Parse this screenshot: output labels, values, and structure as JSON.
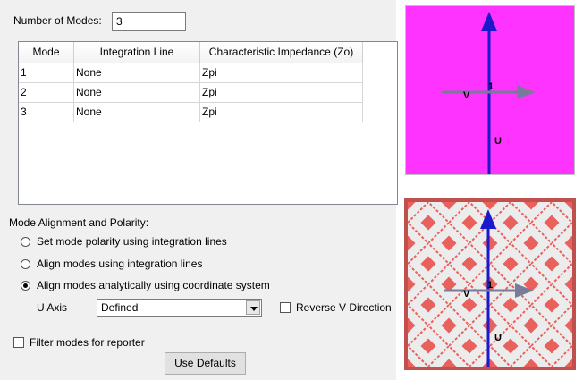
{
  "modes": {
    "label": "Number of Modes:",
    "value": "3"
  },
  "table": {
    "columns": [
      "Mode",
      "Integration Line",
      "Characteristic Impedance (Zo)"
    ],
    "rows": [
      [
        "1",
        "None",
        "Zpi"
      ],
      [
        "2",
        "None",
        "Zpi"
      ],
      [
        "3",
        "None",
        "Zpi"
      ]
    ]
  },
  "alignment": {
    "heading": "Mode Alignment and Polarity:",
    "options": [
      "Set mode polarity using integration lines",
      "Align modes using integration lines",
      "Align modes analytically using coordinate system"
    ],
    "selected_index": 2
  },
  "u_axis": {
    "label": "U Axis",
    "value": "Defined"
  },
  "reverse_v": {
    "label": "Reverse V Direction",
    "checked": false
  },
  "filter": {
    "label": "Filter modes for reporter",
    "checked": false
  },
  "defaults_button": "Use Defaults",
  "preview_top": {
    "background": "#ff33ff",
    "v_label": "V",
    "u_label": "U",
    "center_label": "1"
  },
  "preview_bottom": {
    "border": "#c0504d",
    "pattern_color": "#e9615d",
    "v_label": "V",
    "u_label": "U",
    "center_label": "1"
  }
}
